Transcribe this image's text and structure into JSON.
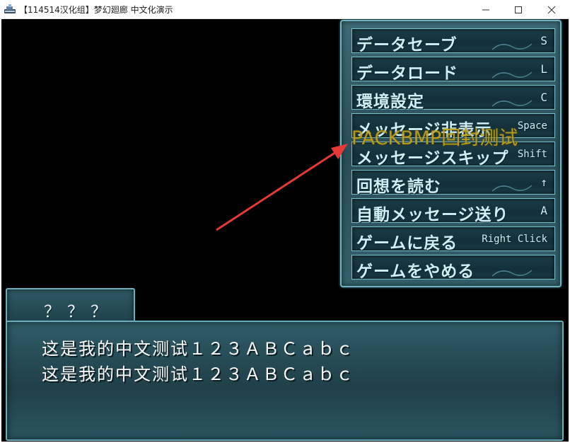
{
  "window": {
    "title": "【114514汉化组】梦幻廻廊 中文化演示",
    "minimize_icon": "minimize-icon",
    "maximize_icon": "maximize-icon",
    "close_icon": "close-icon"
  },
  "menu": {
    "items": [
      {
        "label": "データセーブ",
        "key": "S"
      },
      {
        "label": "データロード",
        "key": "L"
      },
      {
        "label": "環境設定",
        "key": "C"
      },
      {
        "label": "メッセージ非表示",
        "key": "Space"
      },
      {
        "label": "メッセージスキップ",
        "key": "Shift"
      },
      {
        "label": "回想を読む",
        "key": "↑"
      },
      {
        "label": "自動メッセージ送り",
        "key": "A"
      },
      {
        "label": "ゲームに戻る",
        "key": "Right Click"
      },
      {
        "label": "ゲームをやめる",
        "key": ""
      }
    ]
  },
  "watermark": "PACKBMP回封测试",
  "dialogue": {
    "speaker": "？？？",
    "lines": [
      "这是我的中文测试１２３ＡＢＣａｂｃ",
      "这是我的中文测试１２３ＡＢＣａｂｃ"
    ]
  },
  "colors": {
    "panel": "#2a4e58",
    "border": "#6fb4c0",
    "menu_text": "#cfeff6",
    "watermark": "#c7a514",
    "arrow": "#e53935"
  }
}
